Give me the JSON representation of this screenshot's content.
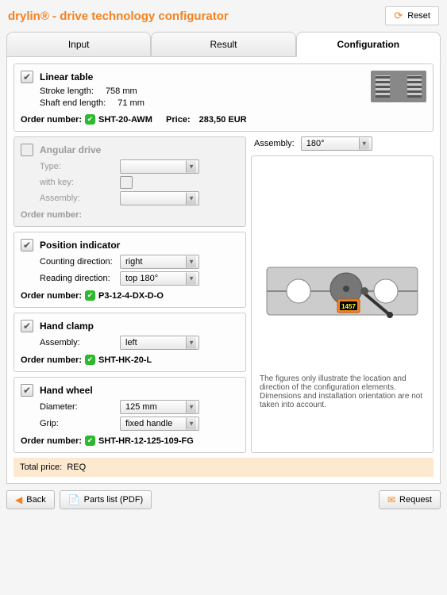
{
  "header": {
    "title": "drylin® - drive technology configurator",
    "reset": "Reset"
  },
  "tabs": {
    "input": "Input",
    "result": "Result",
    "configuration": "Configuration"
  },
  "linear": {
    "title": "Linear table",
    "stroke_label": "Stroke length:",
    "stroke_val": "758 mm",
    "shaft_label": "Shaft end length:",
    "shaft_val": "71 mm",
    "order_label": "Order number:",
    "order_val": "SHT-20-AWM",
    "price_label": "Price:",
    "price_val": "283,50 EUR"
  },
  "angular": {
    "title": "Angular drive",
    "type": "Type:",
    "withkey": "with key:",
    "assembly": "Assembly:",
    "order_label": "Order number:"
  },
  "assembly_right": {
    "label": "Assembly:",
    "value": "180°"
  },
  "position": {
    "title": "Position indicator",
    "count_dir": "Counting direction:",
    "count_val": "right",
    "read_dir": "Reading direction:",
    "read_val": "top 180°",
    "order_label": "Order number:",
    "order_val": "P3-12-4-DX-D-O"
  },
  "handclamp": {
    "title": "Hand clamp",
    "assembly": "Assembly:",
    "assembly_val": "left",
    "order_label": "Order number:",
    "order_val": "SHT-HK-20-L"
  },
  "handwheel": {
    "title": "Hand wheel",
    "diameter": "Diameter:",
    "diameter_val": "125 mm",
    "grip": "Grip:",
    "grip_val": "fixed handle",
    "order_label": "Order number:",
    "order_val": "SHT-HR-12-125-109-FG"
  },
  "illus": {
    "counter_val": "1457",
    "note": "The figures only illustrate the location and direction of the configuration elements.\nDimensions and installation orientation are not taken into account."
  },
  "total": {
    "label": "Total price:",
    "value": "REQ"
  },
  "footer": {
    "back": "Back",
    "parts": "Parts list (PDF)",
    "request": "Request"
  }
}
